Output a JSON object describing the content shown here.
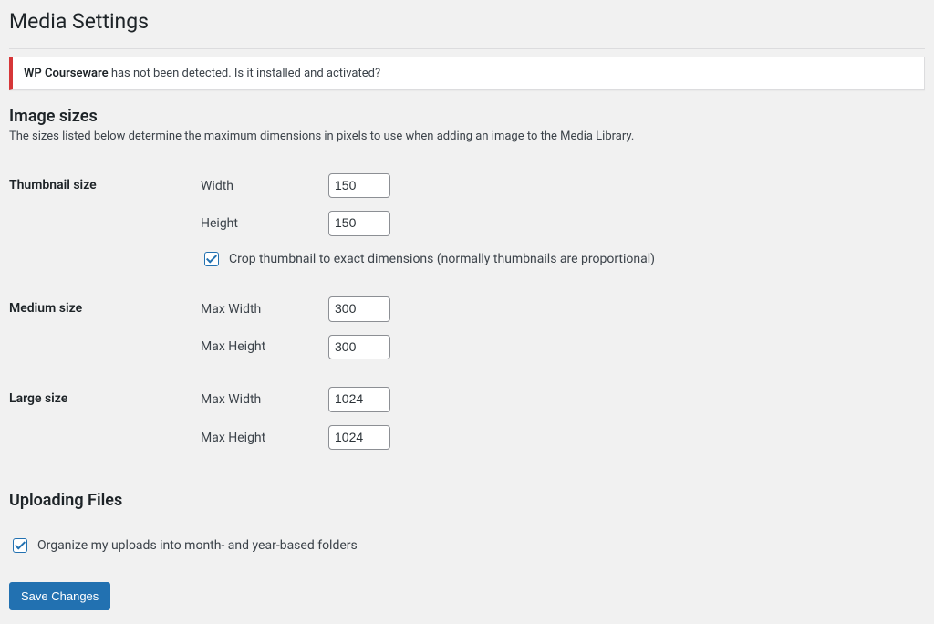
{
  "page": {
    "title": "Media Settings"
  },
  "notice": {
    "strong": "WP Courseware",
    "text": " has not been detected. Is it installed and activated?"
  },
  "image_sizes": {
    "heading": "Image sizes",
    "description": "The sizes listed below determine the maximum dimensions in pixels to use when adding an image to the Media Library.",
    "thumbnail": {
      "label": "Thumbnail size",
      "width_label": "Width",
      "width_value": "150",
      "height_label": "Height",
      "height_value": "150",
      "crop_label": "Crop thumbnail to exact dimensions (normally thumbnails are proportional)",
      "crop_checked": true
    },
    "medium": {
      "label": "Medium size",
      "max_width_label": "Max Width",
      "max_width_value": "300",
      "max_height_label": "Max Height",
      "max_height_value": "300"
    },
    "large": {
      "label": "Large size",
      "max_width_label": "Max Width",
      "max_width_value": "1024",
      "max_height_label": "Max Height",
      "max_height_value": "1024"
    }
  },
  "uploading": {
    "heading": "Uploading Files",
    "organize_label": "Organize my uploads into month- and year-based folders",
    "organize_checked": true
  },
  "submit": {
    "label": "Save Changes"
  }
}
